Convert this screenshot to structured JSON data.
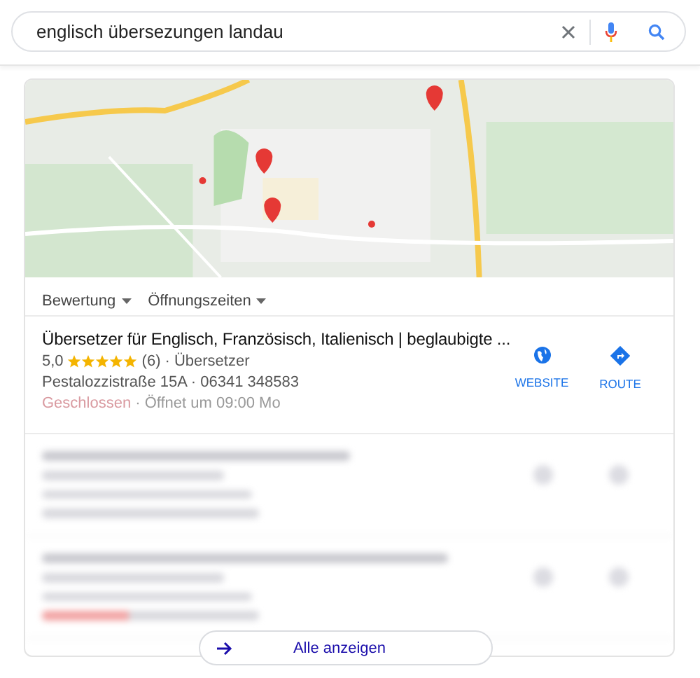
{
  "search": {
    "value": "englisch übersezungen landau"
  },
  "filters": [
    {
      "label": "Bewertung"
    },
    {
      "label": "Öffnungszeiten"
    }
  ],
  "result": {
    "title": "Übersetzer für Englisch, Französisch, Italienisch | beglaubigte ...",
    "rating": "5,0",
    "stars": 5,
    "reviews": "(6)",
    "category": "· Übersetzer",
    "address": "Pestalozzistraße 15A · 06341 348583",
    "status": "Geschlossen",
    "hours": "· Öffnet um 09:00 Mo",
    "actions": [
      {
        "kind": "website",
        "label": "WEBSITE"
      },
      {
        "kind": "route",
        "label": "ROUTE"
      }
    ]
  },
  "blurred_listings": [
    {
      "closed": false
    },
    {
      "closed": true
    }
  ],
  "more_button": {
    "label": "Alle anzeigen"
  }
}
